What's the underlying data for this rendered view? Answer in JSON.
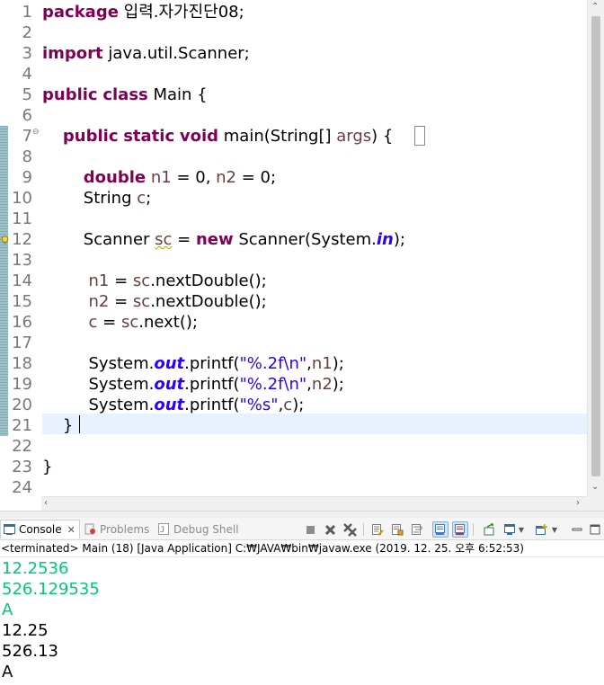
{
  "editor": {
    "line_numbers": [
      "1",
      "2",
      "3",
      "4",
      "5",
      "6",
      "7",
      "8",
      "9",
      "10",
      "11",
      "12",
      "13",
      "14",
      "15",
      "16",
      "17",
      "18",
      "19",
      "20",
      "21",
      "22",
      "23",
      "24"
    ],
    "lines": [
      [
        {
          "t": "package",
          "c": "kw"
        },
        {
          "t": " 입력.자가진단08;",
          "c": ""
        }
      ],
      [],
      [
        {
          "t": "import",
          "c": "kw"
        },
        {
          "t": " java.util.Scanner;",
          "c": ""
        }
      ],
      [],
      [
        {
          "t": "public",
          "c": "kw"
        },
        {
          "t": " ",
          "c": ""
        },
        {
          "t": "class",
          "c": "kw"
        },
        {
          "t": " Main {",
          "c": ""
        }
      ],
      [],
      [
        {
          "t": "    ",
          "c": ""
        },
        {
          "t": "public",
          "c": "kw"
        },
        {
          "t": " ",
          "c": ""
        },
        {
          "t": "static",
          "c": "kw"
        },
        {
          "t": " ",
          "c": ""
        },
        {
          "t": "void",
          "c": "kw"
        },
        {
          "t": " main(String[] ",
          "c": ""
        },
        {
          "t": "args",
          "c": "vr"
        },
        {
          "t": ") {",
          "c": ""
        }
      ],
      [],
      [
        {
          "t": "        ",
          "c": ""
        },
        {
          "t": "double",
          "c": "kw"
        },
        {
          "t": " ",
          "c": ""
        },
        {
          "t": "n1",
          "c": "vr"
        },
        {
          "t": " = 0, ",
          "c": ""
        },
        {
          "t": "n2",
          "c": "vr"
        },
        {
          "t": " = 0;",
          "c": ""
        }
      ],
      [
        {
          "t": "        String ",
          "c": ""
        },
        {
          "t": "c",
          "c": "vr"
        },
        {
          "t": ";",
          "c": ""
        }
      ],
      [],
      [
        {
          "t": "        Scanner ",
          "c": ""
        },
        {
          "t": "sc",
          "c": "vr warn"
        },
        {
          "t": " = ",
          "c": ""
        },
        {
          "t": "new",
          "c": "kw"
        },
        {
          "t": " Scanner(System.",
          "c": ""
        },
        {
          "t": "in",
          "c": "fv"
        },
        {
          "t": ");",
          "c": ""
        }
      ],
      [],
      [
        {
          "t": "         ",
          "c": ""
        },
        {
          "t": "n1",
          "c": "vr"
        },
        {
          "t": " = ",
          "c": ""
        },
        {
          "t": "sc",
          "c": "vr"
        },
        {
          "t": ".nextDouble();",
          "c": ""
        }
      ],
      [
        {
          "t": "         ",
          "c": ""
        },
        {
          "t": "n2",
          "c": "vr"
        },
        {
          "t": " = ",
          "c": ""
        },
        {
          "t": "sc",
          "c": "vr"
        },
        {
          "t": ".nextDouble();",
          "c": ""
        }
      ],
      [
        {
          "t": "         ",
          "c": ""
        },
        {
          "t": "c",
          "c": "vr"
        },
        {
          "t": " = ",
          "c": ""
        },
        {
          "t": "sc",
          "c": "vr"
        },
        {
          "t": ".next();",
          "c": ""
        }
      ],
      [],
      [
        {
          "t": "         System.",
          "c": ""
        },
        {
          "t": "out",
          "c": "fv"
        },
        {
          "t": ".printf(",
          "c": ""
        },
        {
          "t": "\"%.2f\\n\"",
          "c": "st"
        },
        {
          "t": ",",
          "c": ""
        },
        {
          "t": "n1",
          "c": "vr"
        },
        {
          "t": ");",
          "c": ""
        }
      ],
      [
        {
          "t": "         System.",
          "c": ""
        },
        {
          "t": "out",
          "c": "fv"
        },
        {
          "t": ".printf(",
          "c": ""
        },
        {
          "t": "\"%.2f\\n\"",
          "c": "st"
        },
        {
          "t": ",",
          "c": ""
        },
        {
          "t": "n2",
          "c": "vr"
        },
        {
          "t": ");",
          "c": ""
        }
      ],
      [
        {
          "t": "         System.",
          "c": ""
        },
        {
          "t": "out",
          "c": "fv"
        },
        {
          "t": ".printf(",
          "c": ""
        },
        {
          "t": "\"%s\"",
          "c": "st"
        },
        {
          "t": ",",
          "c": ""
        },
        {
          "t": "c",
          "c": "vr"
        },
        {
          "t": ");",
          "c": ""
        }
      ],
      [
        {
          "t": "    }",
          "c": ""
        }
      ],
      [],
      [
        {
          "t": "}",
          "c": ""
        }
      ],
      []
    ],
    "folding_marker": "⊖",
    "colors": {
      "keyword": "#7f0055",
      "field": "#2a00ff",
      "string": "#2a00ff",
      "variable": "#6a3e3e",
      "line_number": "#787878",
      "current_line": "#e8f2fe"
    }
  },
  "console_tabs": [
    {
      "label": "Console",
      "icon": "console-icon",
      "close": "✕",
      "active": true
    },
    {
      "label": "Problems",
      "icon": "problems-icon",
      "active": false
    },
    {
      "label": "Debug Shell",
      "icon": "debug-shell-icon",
      "active": false
    }
  ],
  "toolbar_icons": [
    "stop-square-icon",
    "terminate-icon",
    "remove-all-terminated-icon",
    "clear-console-icon",
    "scroll-lock-icon",
    "word-wrap-icon",
    "show-on-stdout-icon",
    "show-on-stderr-icon",
    "pin-console-icon",
    "display-selected-console-icon",
    "dropdown-icon",
    "open-console-icon",
    "dropdown-icon",
    "minimize-icon",
    "maximize-icon"
  ],
  "status": "<terminated> Main (18) [Java Application] C:₩JAVA₩bin₩javaw.exe (2019. 12. 25. 오후 6:52:53)",
  "output": [
    {
      "text": "12.2536",
      "kind": "input"
    },
    {
      "text": "526.129535",
      "kind": "input"
    },
    {
      "text": "A",
      "kind": "input"
    },
    {
      "text": "12.25",
      "kind": "output"
    },
    {
      "text": "526.13",
      "kind": "output"
    },
    {
      "text": "A",
      "kind": "output"
    }
  ],
  "colors": {
    "stdin": "#00c87d",
    "stdout": "#000000"
  }
}
